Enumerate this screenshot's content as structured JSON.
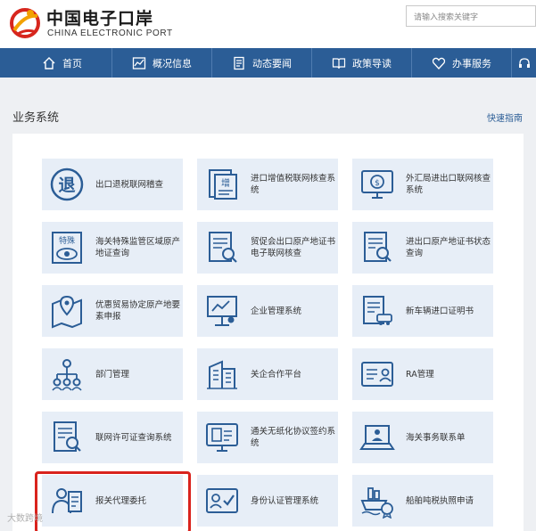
{
  "header": {
    "brand_cn": "中国电子口岸",
    "brand_en": "CHINA ELECTRONIC PORT",
    "search_placeholder": "请输入搜索关键字"
  },
  "nav": [
    {
      "label": "首页",
      "icon": "home-icon"
    },
    {
      "label": "概况信息",
      "icon": "chart-icon"
    },
    {
      "label": "动态要闻",
      "icon": "news-icon"
    },
    {
      "label": "政策导读",
      "icon": "book-icon"
    },
    {
      "label": "办事服务",
      "icon": "heart-icon"
    }
  ],
  "section": {
    "title": "业务系统",
    "quick_guide": "快速指南"
  },
  "tiles": [
    {
      "label": "出口退税联网稽查",
      "icon": "tax-refund-icon"
    },
    {
      "label": "进口增值税联网核查系统",
      "icon": "vat-document-icon"
    },
    {
      "label": "外汇局进出口联网核查系统",
      "icon": "forex-monitor-icon"
    },
    {
      "label": "海关特殊监管区域原产地证查询",
      "icon": "special-zone-eye-icon"
    },
    {
      "label": "贸促会出口原产地证书电子联网核查",
      "icon": "certificate-search-icon"
    },
    {
      "label": "进出口原产地证书状态查询",
      "icon": "document-magnifier-icon"
    },
    {
      "label": "优惠贸易协定原产地要素申报",
      "icon": "map-pin-icon"
    },
    {
      "label": "企业管理系统",
      "icon": "presenter-board-icon"
    },
    {
      "label": "新车辆进口证明书",
      "icon": "vehicle-document-icon"
    },
    {
      "label": "部门管理",
      "icon": "org-chart-icon"
    },
    {
      "label": "关企合作平台",
      "icon": "building-icon"
    },
    {
      "label": "RA管理",
      "icon": "id-card-icon"
    },
    {
      "label": "联网许可证查询系统",
      "icon": "license-search-icon"
    },
    {
      "label": "通关无纸化协议签约系统",
      "icon": "paperless-screen-icon"
    },
    {
      "label": "海关事务联系单",
      "icon": "laptop-contact-icon"
    },
    {
      "label": "报关代理委托",
      "icon": "agent-clipboard-icon"
    },
    {
      "label": "身份认证管理系统",
      "icon": "identity-check-icon"
    },
    {
      "label": "船舶吨税执照申请",
      "icon": "ship-icon"
    }
  ],
  "watermark": "大数跨境"
}
